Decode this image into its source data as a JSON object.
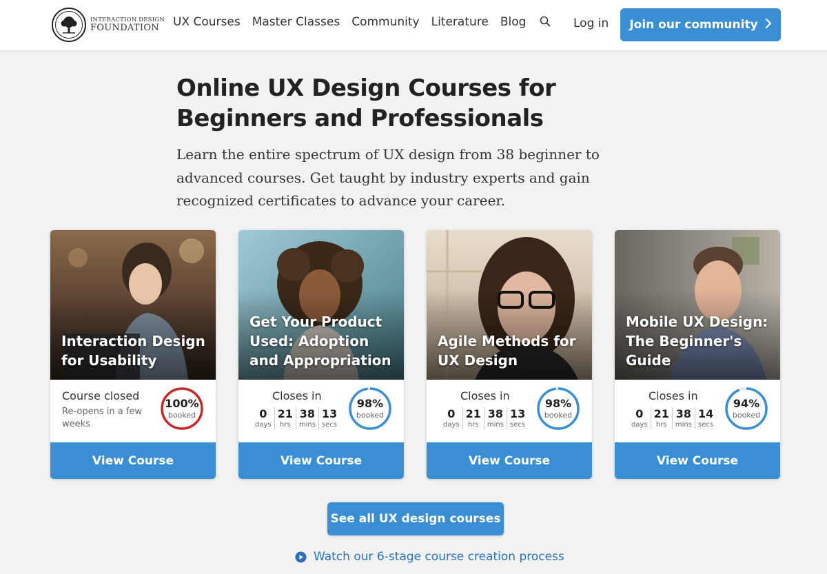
{
  "header": {
    "logo_line1": "INTERACTION DESIGN",
    "logo_line2": "FOUNDATION",
    "nav": [
      "UX Courses",
      "Master Classes",
      "Community",
      "Literature",
      "Blog"
    ],
    "search_icon": "search-icon",
    "login": "Log in",
    "join_button": "Join our community"
  },
  "hero": {
    "title": "Online UX Design Courses for Beginners and Professionals",
    "description": "Learn the entire spectrum of UX design from 38 beginner to advanced courses. Get taught by industry experts and gain recognized certificates to advance your career."
  },
  "cards": [
    {
      "title": "Interaction Design for Usability",
      "status": "Course closed",
      "sub": "Re-opens in a few weeks",
      "booked_pct": "100%",
      "booked_fraction": 1.0,
      "booked_label": "booked",
      "ring_color": "#c62828",
      "button": "View Course"
    },
    {
      "title": "Get Your Product Used: Adoption and Appropriation",
      "status": "Closes in",
      "countdown": [
        {
          "num": "0",
          "label": "days"
        },
        {
          "num": "21",
          "label": "hrs"
        },
        {
          "num": "38",
          "label": "mins"
        },
        {
          "num": "13",
          "label": "secs"
        }
      ],
      "booked_pct": "98%",
      "booked_fraction": 0.98,
      "booked_label": "booked",
      "ring_color": "#3a8fd4",
      "button": "View Course"
    },
    {
      "title": "Agile Methods for UX Design",
      "status": "Closes in",
      "countdown": [
        {
          "num": "0",
          "label": "days"
        },
        {
          "num": "21",
          "label": "hrs"
        },
        {
          "num": "38",
          "label": "mins"
        },
        {
          "num": "13",
          "label": "secs"
        }
      ],
      "booked_pct": "98%",
      "booked_fraction": 0.98,
      "booked_label": "booked",
      "ring_color": "#3a8fd4",
      "button": "View Course"
    },
    {
      "title": "Mobile UX Design: The Beginner's Guide",
      "status": "Closes in",
      "countdown": [
        {
          "num": "0",
          "label": "days"
        },
        {
          "num": "21",
          "label": "hrs"
        },
        {
          "num": "38",
          "label": "mins"
        },
        {
          "num": "14",
          "label": "secs"
        }
      ],
      "booked_pct": "94%",
      "booked_fraction": 0.94,
      "booked_label": "booked",
      "ring_color": "#3a8fd4",
      "button": "View Course"
    }
  ],
  "see_all_button": "See all UX design courses",
  "watch_link": "Watch our 6-stage course creation process",
  "colors": {
    "accent": "#3a8fd4",
    "link": "#2a70b8",
    "closed_ring": "#c62828"
  }
}
